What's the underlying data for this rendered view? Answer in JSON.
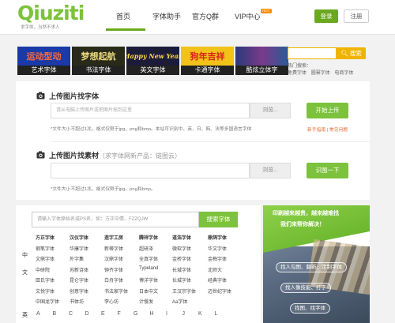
{
  "header": {
    "logo_text": "Qiuziti",
    "slogan": "求字体，当然不求人",
    "nav": [
      {
        "label": "首页",
        "active": true
      },
      {
        "label": "字体助手",
        "active": false
      },
      {
        "label": "官方Q群",
        "active": false
      },
      {
        "label": "VIP中心",
        "active": false
      }
    ],
    "vip_badge": "HOT",
    "login": "登录",
    "register": "注册",
    "accent_color": "#6aa81f"
  },
  "categories": [
    {
      "art": "运动型动",
      "label": "艺术字体",
      "bg": "#1a3aa8",
      "fg": "#ff6a3a"
    },
    {
      "art": "梦想起航",
      "label": "书法字体",
      "bg": "#2a2a1a",
      "fg": "#e8d87a"
    },
    {
      "art": "Happy New Year",
      "label": "英文字体",
      "bg": "#1c1c3a",
      "fg": "#ffd84a"
    },
    {
      "art": "狗年吉祥",
      "label": "卡通字体",
      "bg": "#f2c21a",
      "fg": "#d8201a"
    },
    {
      "art": "",
      "label": "酷炫立体字",
      "bg": "#2a3a7a",
      "fg": "#ffffff"
    }
  ],
  "search": {
    "button": "搜索",
    "hot_label": "热门搜索：",
    "hot_links": [
      "免费字体",
      "圆幂字体",
      "电商字体"
    ]
  },
  "upload": {
    "image_title": "上传图片找字体",
    "image_placeholder": "请从电脑上传图片或把图片拖到这里",
    "browse": "浏览...",
    "start_upload": "开始上传",
    "image_note": "*文件大小不超过1兆，格式仅限于jpg、png和bmp。本站可识别中、英、日、韩、法等多国语言字体",
    "help_links": "新手指南 | 常见问题",
    "asset_title": "上传图片找素材",
    "asset_sub": "（求字体网新产品：链图云）",
    "asset_browse": "浏览...",
    "asset_search": "识图一下",
    "asset_note": "*文件大小不超过1兆，格式仅限于jpg、png和bmp。"
  },
  "font_list": {
    "search_placeholder": "请输入字体原始名或PS名，如：方正中倩、FZZQJW",
    "search_button": "搜索字体",
    "side_label_1": "中",
    "side_label_2": "文",
    "side_label_3": "英",
    "rows": [
      [
        "方正字体",
        "汉仪字体",
        "造字工房",
        "腾祥字体",
        "道浩字体",
        "鼎鸽字体"
      ],
      [
        "钢笔字体",
        "华康字体",
        "新蒂字体",
        "超研泽",
        "微软字体",
        "华文字体"
      ],
      [
        "文鼎字体",
        "外字集",
        "汉鼎字体",
        "全真字体",
        "金桥字体",
        "金梅字体"
      ],
      [
        "中研院",
        "苏新诗体",
        "钟齐字体",
        "Typeland",
        "长城字体",
        "北师大"
      ],
      [
        "田氏字体",
        "昆仑字体",
        "白舟字体",
        "博洋字体",
        "长城字体",
        "经典字体"
      ],
      [
        "文悦字体",
        "创意字体",
        "书法家字体",
        "日本中文",
        "王汉宗字体",
        "迈世纪字体"
      ],
      [
        "中国龙字体",
        "书体坊",
        "李心坊",
        "计慢发",
        "Aa字体",
        ""
      ]
    ],
    "alphabet": [
      "A",
      "B",
      "C",
      "D",
      "E",
      "F",
      "G",
      "H",
      "I",
      "J",
      "K",
      "L"
    ]
  },
  "ad": {
    "line1": "印刷越来越贵，越来越难找",
    "line2": "我们来帮你解决！",
    "pills": [
      "找人勾图、翻新、定制字体",
      "找人像技能、打字",
      "找图、找字体"
    ]
  }
}
